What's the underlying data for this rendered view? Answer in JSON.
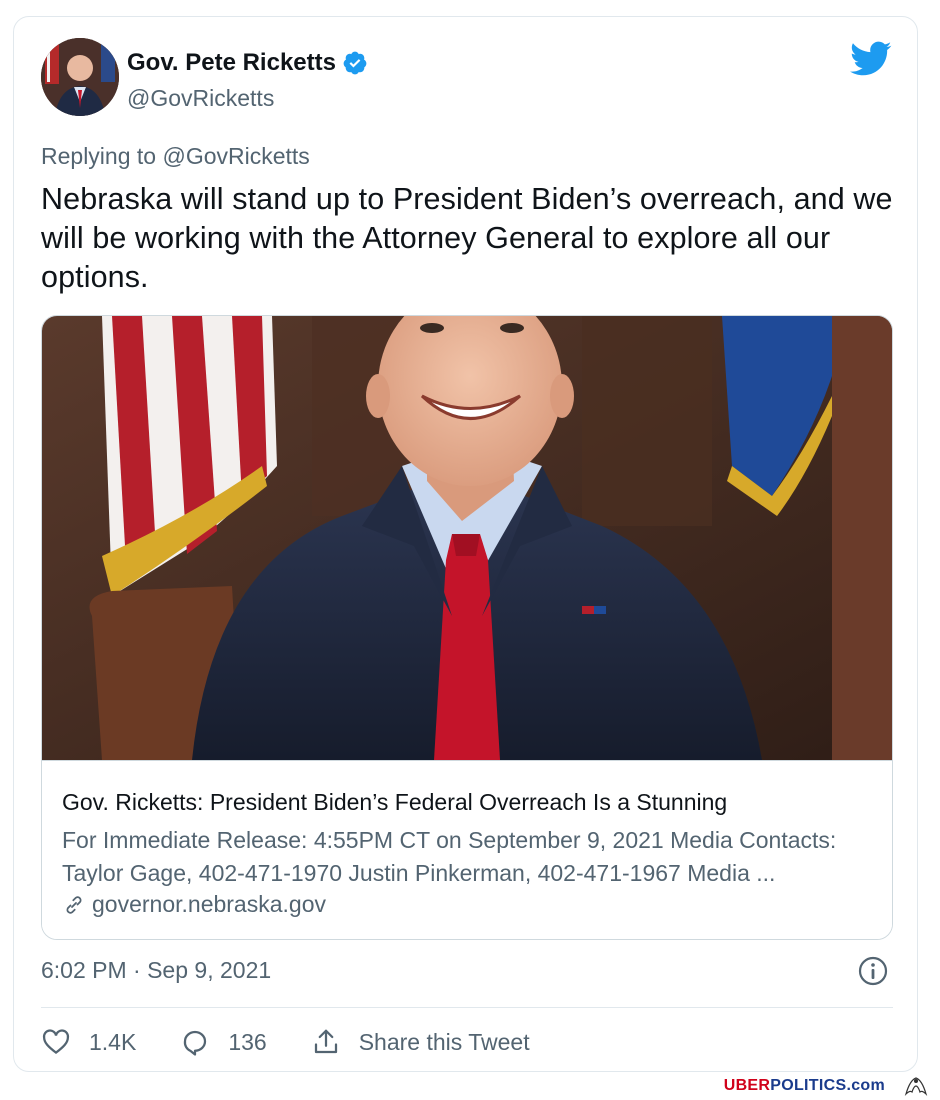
{
  "tweet": {
    "author_name": "Gov. Pete Ricketts",
    "author_handle": "@GovRicketts",
    "replying_prefix": "Replying to",
    "replying_to": "@GovRicketts",
    "text": "Nebraska will stand up to President Biden’s overreach, and we will be working with the Attorney General to explore all our options.",
    "timestamp": "6:02 PM · Sep 9, 2021"
  },
  "link_card": {
    "title": "Gov. Ricketts: President Biden’s Federal Overreach Is a Stunning",
    "description": "For Immediate Release: 4:55PM CT on September 9, 2021 Media Contacts: Taylor Gage, 402-471-1970 Justin Pinkerman, 402-471-1967 Media ...",
    "domain": "governor.nebraska.gov"
  },
  "actions": {
    "likes": "1.4K",
    "replies": "136",
    "share_label": "Share this Tweet"
  },
  "watermark": {
    "part1": "UBER",
    "part2": "POLITICS",
    "part3": ".com"
  },
  "colors": {
    "twitter_blue": "#1d9bf0",
    "secondary_text": "#536471",
    "brand_red": "#d0021b",
    "brand_blue": "#1a3b8c"
  },
  "icons": {
    "verified": "verified-badge-icon",
    "bird": "twitter-bird-icon",
    "info": "info-icon",
    "link": "link-icon",
    "like": "heart-icon",
    "reply": "reply-bubble-icon",
    "share": "share-icon"
  }
}
